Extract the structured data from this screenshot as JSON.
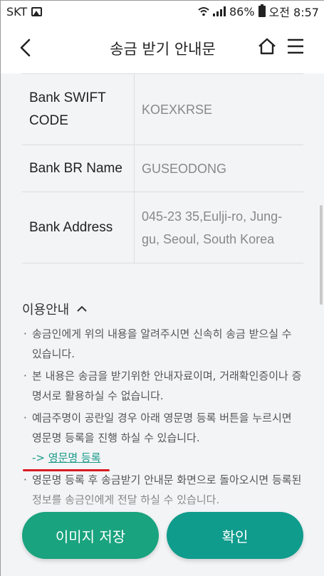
{
  "status_bar": {
    "carrier": "SKT",
    "battery": "86%",
    "time": "오전 8:57"
  },
  "header": {
    "title": "송금 받기 안내문"
  },
  "bank_info": [
    {
      "label": "Bank SWIFT CODE",
      "value": "KOEXKRSE"
    },
    {
      "label": "Bank BR Name",
      "value": "GUSEODONG"
    },
    {
      "label": "Bank Address",
      "value": "045-23 35,Eulji-ro, Jung-gu, Seoul, South Korea"
    }
  ],
  "guide": {
    "title": "이용안내",
    "items": [
      "송금인에게 위의 내용을 알려주시면 신속히 송금 받으실 수 있습니다.",
      "본 내용은 송금을 받기위한 안내자료이며, 거래확인증이나 증명서로 활용하실 수 없습니다.",
      "예금주명이 공란일 경우 아래 영문명 등록 버튼을 누르시면 영문명 등록을 진행 하실 수 있습니다.",
      "영문명 등록 후 송금받기 안내문 화면으로 돌아오시면 등록된 정보를 송금인에게 전달 하실 수 있습니다."
    ],
    "link_prefix": "->",
    "link_label": "영문명 등록"
  },
  "buttons": {
    "save_image": "이미지 저장",
    "confirm": "확인"
  },
  "colors": {
    "save_button": "#19a37e",
    "confirm_button": "#0f9c8c",
    "link": "#1a9a8a",
    "link_underline_mark": "#d91a22"
  }
}
